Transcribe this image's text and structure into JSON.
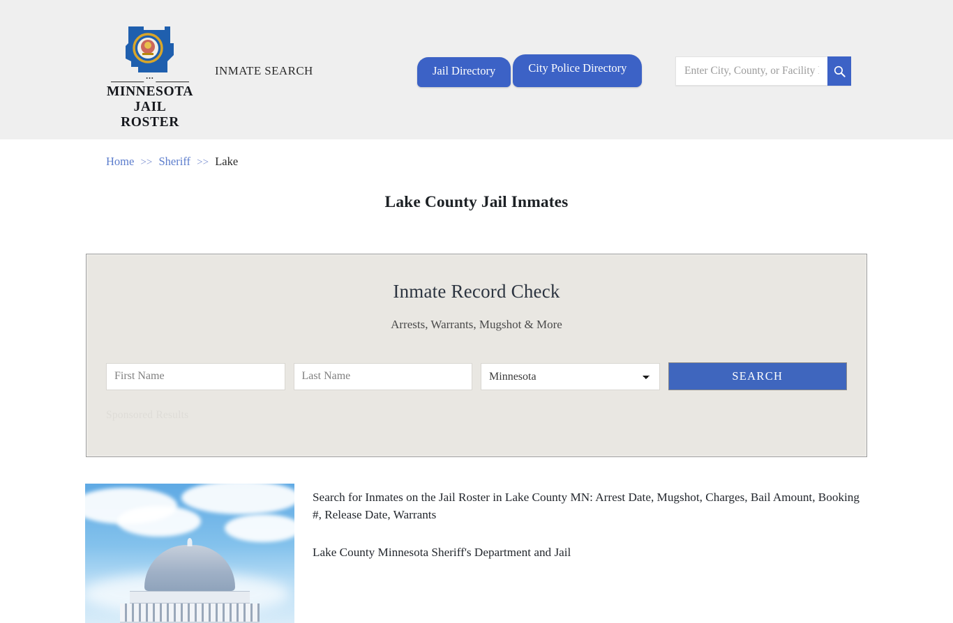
{
  "header": {
    "brand": {
      "line1": "MINNESOTA",
      "line2": "JAIL ROSTER",
      "logo_icon": "minnesota-state-seal-icon"
    },
    "tagline": "INMATE SEARCH",
    "nav": [
      {
        "label": "Jail Directory"
      },
      {
        "label": "City Police Directory"
      }
    ],
    "search": {
      "placeholder": "Enter City, County, or Facility Name",
      "value": "",
      "button_icon": "search-icon"
    },
    "background_color": "#efefef",
    "accent_color": "#3c62c6"
  },
  "breadcrumb": {
    "items": [
      {
        "label": "Home",
        "link": true
      },
      {
        "label": "Sheriff",
        "link": true
      },
      {
        "label": "Lake",
        "link": false
      }
    ],
    "separator": ">>"
  },
  "page_title": "Lake County Jail Inmates",
  "record_check": {
    "title": "Inmate Record Check",
    "subtitle": "Arrests, Warrants, Mugshot & More",
    "first_name": {
      "placeholder": "First Name",
      "value": ""
    },
    "last_name": {
      "placeholder": "Last Name",
      "value": ""
    },
    "state": {
      "selected": "Minnesota",
      "options": [
        "Minnesota"
      ]
    },
    "submit_label": "SEARCH",
    "sponsored_label": "Sponsored Results",
    "panel_background": "#e9e7e2",
    "submit_color": "#3f66be"
  },
  "bottom": {
    "image_alt": "county-courthouse-dome-photo",
    "paragraph_1": "Search for Inmates on the Jail Roster in Lake County MN: Arrest Date, Mugshot, Charges, Bail Amount, Booking #, Release Date, Warrants",
    "paragraph_2": "Lake County Minnesota Sheriff's Department and Jail"
  }
}
